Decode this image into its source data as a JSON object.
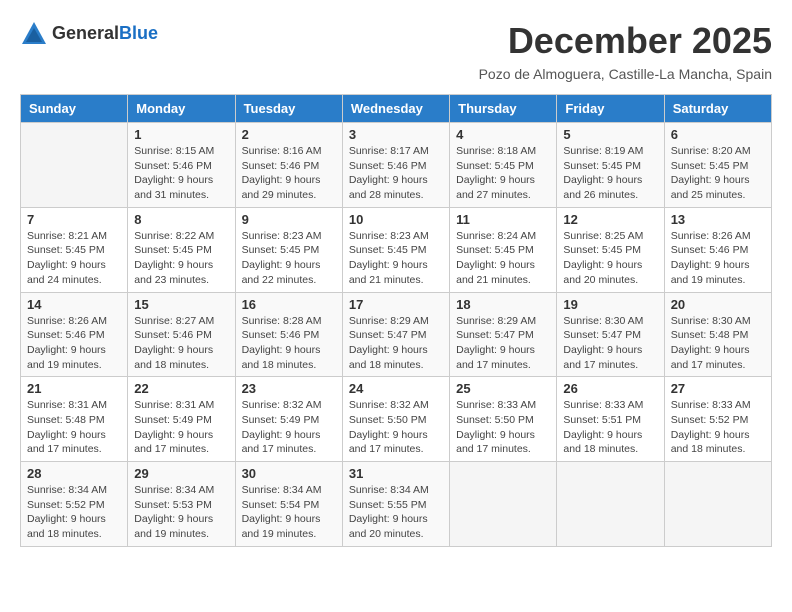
{
  "header": {
    "logo_general": "General",
    "logo_blue": "Blue",
    "month_title": "December 2025",
    "subtitle": "Pozo de Almoguera, Castille-La Mancha, Spain"
  },
  "days_of_week": [
    "Sunday",
    "Monday",
    "Tuesday",
    "Wednesday",
    "Thursday",
    "Friday",
    "Saturday"
  ],
  "weeks": [
    [
      {
        "day": "",
        "info": ""
      },
      {
        "day": "1",
        "info": "Sunrise: 8:15 AM\nSunset: 5:46 PM\nDaylight: 9 hours\nand 31 minutes."
      },
      {
        "day": "2",
        "info": "Sunrise: 8:16 AM\nSunset: 5:46 PM\nDaylight: 9 hours\nand 29 minutes."
      },
      {
        "day": "3",
        "info": "Sunrise: 8:17 AM\nSunset: 5:46 PM\nDaylight: 9 hours\nand 28 minutes."
      },
      {
        "day": "4",
        "info": "Sunrise: 8:18 AM\nSunset: 5:45 PM\nDaylight: 9 hours\nand 27 minutes."
      },
      {
        "day": "5",
        "info": "Sunrise: 8:19 AM\nSunset: 5:45 PM\nDaylight: 9 hours\nand 26 minutes."
      },
      {
        "day": "6",
        "info": "Sunrise: 8:20 AM\nSunset: 5:45 PM\nDaylight: 9 hours\nand 25 minutes."
      }
    ],
    [
      {
        "day": "7",
        "info": "Sunrise: 8:21 AM\nSunset: 5:45 PM\nDaylight: 9 hours\nand 24 minutes."
      },
      {
        "day": "8",
        "info": "Sunrise: 8:22 AM\nSunset: 5:45 PM\nDaylight: 9 hours\nand 23 minutes."
      },
      {
        "day": "9",
        "info": "Sunrise: 8:23 AM\nSunset: 5:45 PM\nDaylight: 9 hours\nand 22 minutes."
      },
      {
        "day": "10",
        "info": "Sunrise: 8:23 AM\nSunset: 5:45 PM\nDaylight: 9 hours\nand 21 minutes."
      },
      {
        "day": "11",
        "info": "Sunrise: 8:24 AM\nSunset: 5:45 PM\nDaylight: 9 hours\nand 21 minutes."
      },
      {
        "day": "12",
        "info": "Sunrise: 8:25 AM\nSunset: 5:45 PM\nDaylight: 9 hours\nand 20 minutes."
      },
      {
        "day": "13",
        "info": "Sunrise: 8:26 AM\nSunset: 5:46 PM\nDaylight: 9 hours\nand 19 minutes."
      }
    ],
    [
      {
        "day": "14",
        "info": "Sunrise: 8:26 AM\nSunset: 5:46 PM\nDaylight: 9 hours\nand 19 minutes."
      },
      {
        "day": "15",
        "info": "Sunrise: 8:27 AM\nSunset: 5:46 PM\nDaylight: 9 hours\nand 18 minutes."
      },
      {
        "day": "16",
        "info": "Sunrise: 8:28 AM\nSunset: 5:46 PM\nDaylight: 9 hours\nand 18 minutes."
      },
      {
        "day": "17",
        "info": "Sunrise: 8:29 AM\nSunset: 5:47 PM\nDaylight: 9 hours\nand 18 minutes."
      },
      {
        "day": "18",
        "info": "Sunrise: 8:29 AM\nSunset: 5:47 PM\nDaylight: 9 hours\nand 17 minutes."
      },
      {
        "day": "19",
        "info": "Sunrise: 8:30 AM\nSunset: 5:47 PM\nDaylight: 9 hours\nand 17 minutes."
      },
      {
        "day": "20",
        "info": "Sunrise: 8:30 AM\nSunset: 5:48 PM\nDaylight: 9 hours\nand 17 minutes."
      }
    ],
    [
      {
        "day": "21",
        "info": "Sunrise: 8:31 AM\nSunset: 5:48 PM\nDaylight: 9 hours\nand 17 minutes."
      },
      {
        "day": "22",
        "info": "Sunrise: 8:31 AM\nSunset: 5:49 PM\nDaylight: 9 hours\nand 17 minutes."
      },
      {
        "day": "23",
        "info": "Sunrise: 8:32 AM\nSunset: 5:49 PM\nDaylight: 9 hours\nand 17 minutes."
      },
      {
        "day": "24",
        "info": "Sunrise: 8:32 AM\nSunset: 5:50 PM\nDaylight: 9 hours\nand 17 minutes."
      },
      {
        "day": "25",
        "info": "Sunrise: 8:33 AM\nSunset: 5:50 PM\nDaylight: 9 hours\nand 17 minutes."
      },
      {
        "day": "26",
        "info": "Sunrise: 8:33 AM\nSunset: 5:51 PM\nDaylight: 9 hours\nand 18 minutes."
      },
      {
        "day": "27",
        "info": "Sunrise: 8:33 AM\nSunset: 5:52 PM\nDaylight: 9 hours\nand 18 minutes."
      }
    ],
    [
      {
        "day": "28",
        "info": "Sunrise: 8:34 AM\nSunset: 5:52 PM\nDaylight: 9 hours\nand 18 minutes."
      },
      {
        "day": "29",
        "info": "Sunrise: 8:34 AM\nSunset: 5:53 PM\nDaylight: 9 hours\nand 19 minutes."
      },
      {
        "day": "30",
        "info": "Sunrise: 8:34 AM\nSunset: 5:54 PM\nDaylight: 9 hours\nand 19 minutes."
      },
      {
        "day": "31",
        "info": "Sunrise: 8:34 AM\nSunset: 5:55 PM\nDaylight: 9 hours\nand 20 minutes."
      },
      {
        "day": "",
        "info": ""
      },
      {
        "day": "",
        "info": ""
      },
      {
        "day": "",
        "info": ""
      }
    ]
  ]
}
